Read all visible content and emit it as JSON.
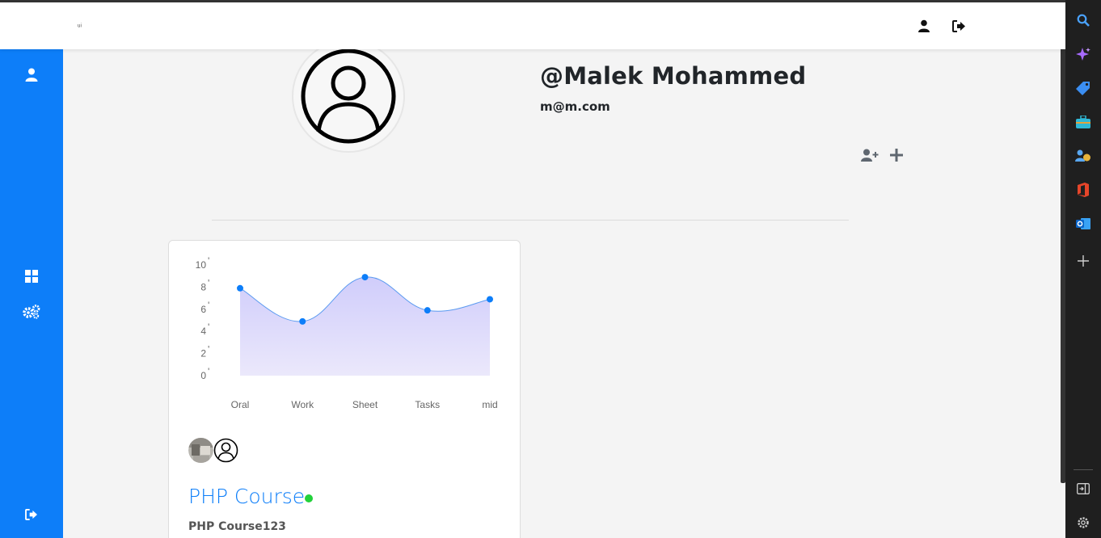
{
  "header": {
    "brand_text": "ᵤᵢ",
    "profile_icon": "user-icon",
    "logout_icon": "sign-out-icon"
  },
  "sidebar": {
    "items": [
      {
        "icon": "user-icon"
      },
      {
        "icon": "grid-icon"
      },
      {
        "icon": "gears-icon"
      },
      {
        "icon": "sign-out-icon"
      }
    ],
    "accent": "#0d7ef9"
  },
  "profile": {
    "username": "@Malek Mohammed",
    "email": "m@m.com",
    "actions": [
      {
        "icon": "user-plus-icon"
      },
      {
        "icon": "plus-icon"
      }
    ]
  },
  "course_card": {
    "title": "PHP Course",
    "subtitle": "PHP Course123",
    "status_color": "#22d13a"
  },
  "chart_data": {
    "type": "area",
    "categories": [
      "Oral",
      "Work",
      "Sheet",
      "Tasks",
      "mid"
    ],
    "values": [
      7.9,
      4.9,
      8.9,
      5.9,
      6.9
    ],
    "ylim": [
      0,
      10
    ],
    "yticks": [
      0,
      2,
      4,
      6,
      8,
      10
    ],
    "smooth": true,
    "line_color": "#5a9af0",
    "point_color": "#0d7ef9",
    "fill_color": "#d6d4fb",
    "grid": false
  },
  "edge_bar": {
    "icons": [
      "search-icon",
      "copilot-icon",
      "tag-icon",
      "toolbox-icon",
      "people-icon",
      "office-icon",
      "outlook-icon",
      "add-icon",
      "sidebar-toggle-icon",
      "settings-icon"
    ]
  }
}
